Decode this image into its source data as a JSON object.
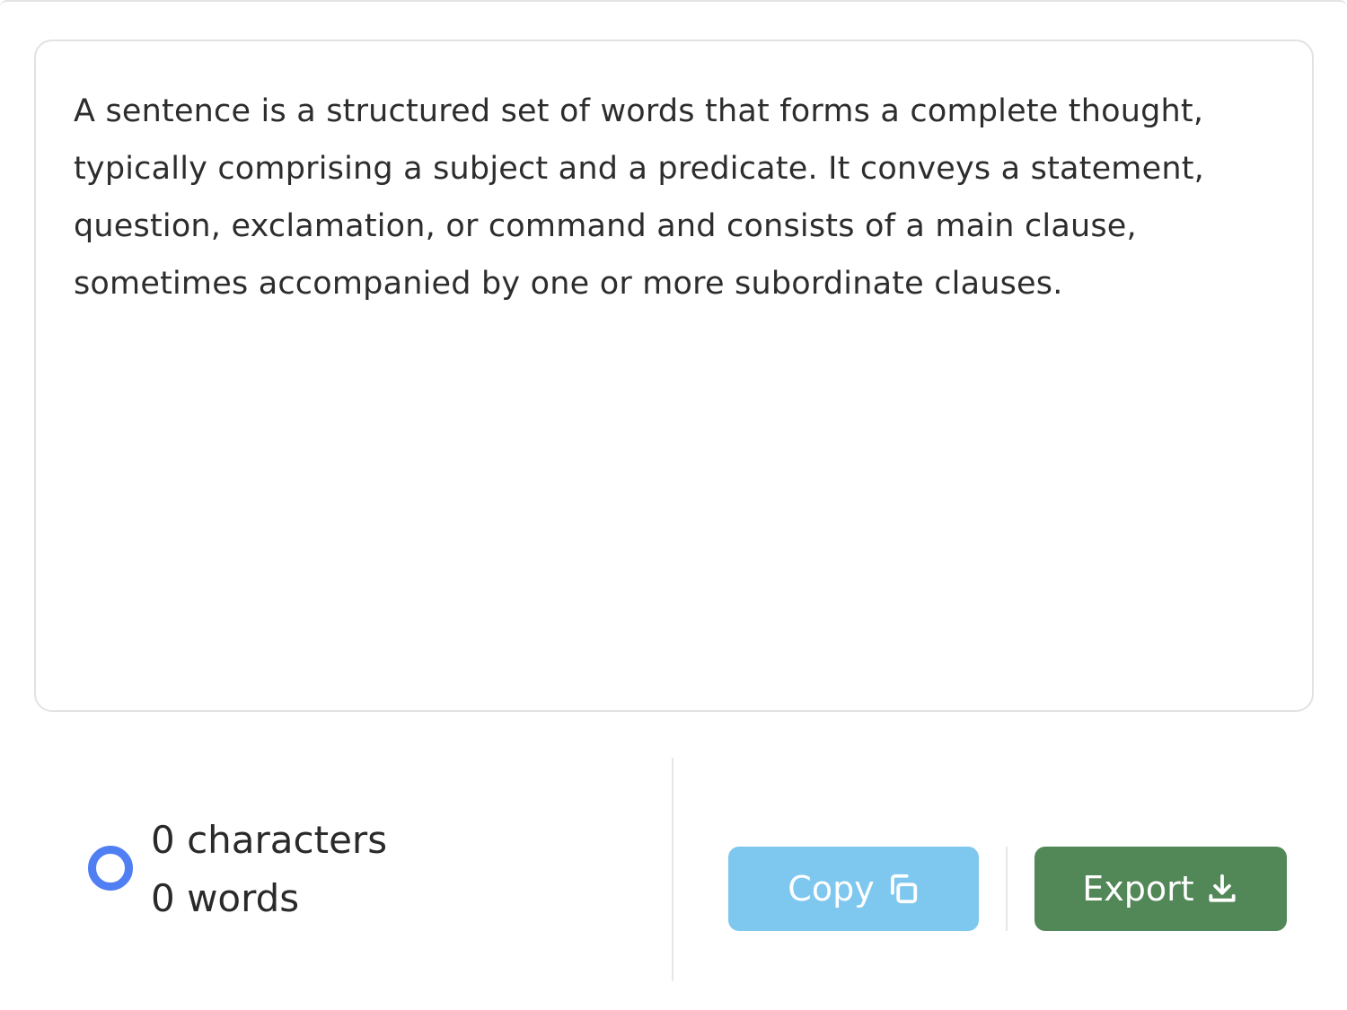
{
  "editor": {
    "text": "A sentence is a structured set of words that forms a complete thought, typically comprising a subject and a predicate. It conveys a statement, question, exclamation, or command and consists of a main clause, sometimes accompanied by one or more subordinate clauses."
  },
  "stats": {
    "characters_label": "0 characters",
    "words_label": "0 words",
    "status_icon": "status-ring-icon"
  },
  "actions": {
    "copy_label": "Copy",
    "copy_icon": "copy-icon",
    "export_label": "Export",
    "export_icon": "download-icon"
  },
  "colors": {
    "copy_button": "#7ec7ee",
    "export_button": "#528757",
    "status_ring": "#4f7ff3",
    "text": "#2d2d2d"
  }
}
